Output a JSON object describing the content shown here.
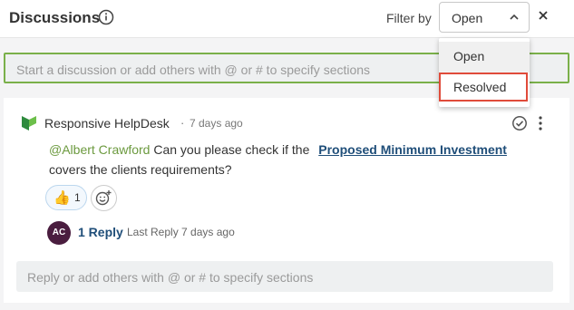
{
  "header": {
    "title": "Discussions",
    "info_icon": "info-circle-icon",
    "filter_label": "Filter by",
    "filter_value": "Open",
    "close_icon": "close-icon"
  },
  "filter_dropdown": {
    "options": [
      "Open",
      "Resolved"
    ],
    "highlighted": "Resolved",
    "highlight_color": "#e04b3a"
  },
  "compose": {
    "placeholder": "Start a discussion or add others with @ or # to specify sections",
    "border_color": "#7ab04a"
  },
  "discussion": {
    "author": "Responsive HelpDesk",
    "separator": "·",
    "time": "7 days ago",
    "mention": "@Albert Crawford",
    "text_before_link": "Can you please check if the",
    "link_text": "Proposed Minimum Investment",
    "text_after_link": "covers the clients requirements?",
    "reaction": {
      "emoji": "👍",
      "count": "1"
    },
    "reply_avatar_initials": "AC",
    "reply_count_label": "1 Reply",
    "last_reply": "Last Reply 7 days ago",
    "reply_placeholder": "Reply or add others with @ or # to specify sections",
    "avatar_color": "#4a1d3f",
    "mention_color": "#6c9a3f",
    "link_color": "#1f4e79"
  }
}
